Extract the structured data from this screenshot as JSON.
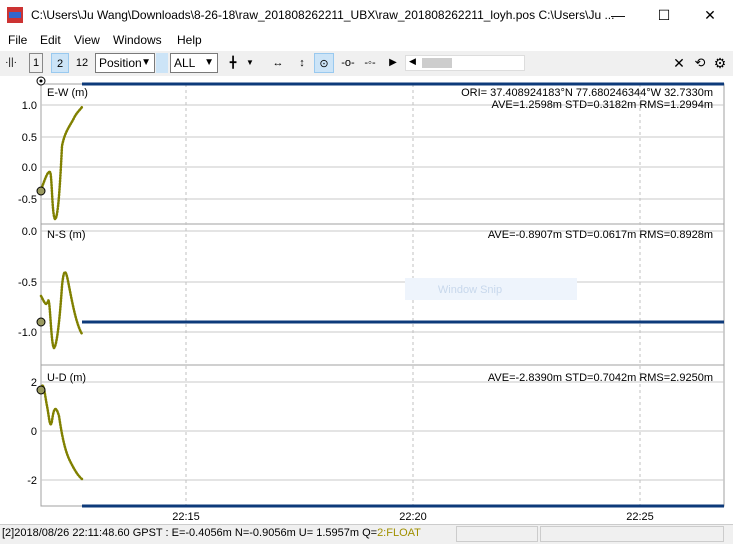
{
  "window": {
    "title": "C:\\Users\\Ju Wang\\Downloads\\8-26-18\\raw_201808262211_UBX\\raw_201808262211_loyh.pos C:\\Users\\Ju ...",
    "minimize_glyph": "—",
    "maximize_glyph": "☐",
    "close_glyph": "✕"
  },
  "menu": [
    "File",
    "Edit",
    "View",
    "Windows",
    "Help"
  ],
  "toolbar": {
    "btn1": "1",
    "btn2": "2",
    "btn12": "12",
    "plot_type": "Position",
    "sat_select": "ALL",
    "icons": [
      "grip-icon",
      "crosshair-icon",
      "fit-horizontal-icon",
      "fit-vertical-icon",
      "center-origin-icon",
      "show-track-icon",
      "point-icon",
      "play-icon",
      "close-icon",
      "reload-icon",
      "settings-icon"
    ]
  },
  "plot": {
    "ew": {
      "label": "E-W (m)",
      "ori": "ORI= 37.408924183°N   77.680246344°W 32.7330m",
      "stats": "AVE=1.2598m STD=0.3182m RMS=1.2994m",
      "ticks": [
        "1.0",
        "0.5",
        "0.0",
        "-0.5"
      ]
    },
    "ns": {
      "label": "N-S (m)",
      "stats": "AVE=-0.8907m STD=0.0617m RMS=0.8928m",
      "ticks": [
        "0.0",
        "-0.5",
        "-1.0"
      ]
    },
    "ud": {
      "label": "U-D (m)",
      "stats": "AVE=-2.8390m STD=0.7042m RMS=2.9250m",
      "ticks": [
        "2",
        "0",
        "-2"
      ]
    },
    "time_ticks": [
      "22:15",
      "22:20",
      "22:25"
    ],
    "watermark": "Window Snip",
    "colors": {
      "float": "#808000",
      "bar": "#0d3a7a",
      "grid": "#c0c0c0"
    }
  },
  "status": {
    "text": "[2]2018/08/26 22:11:48.60 GPST : E=-0.4056m N=-0.9056m U= 1.5957m Q=",
    "quality": "2:FLOAT"
  }
}
